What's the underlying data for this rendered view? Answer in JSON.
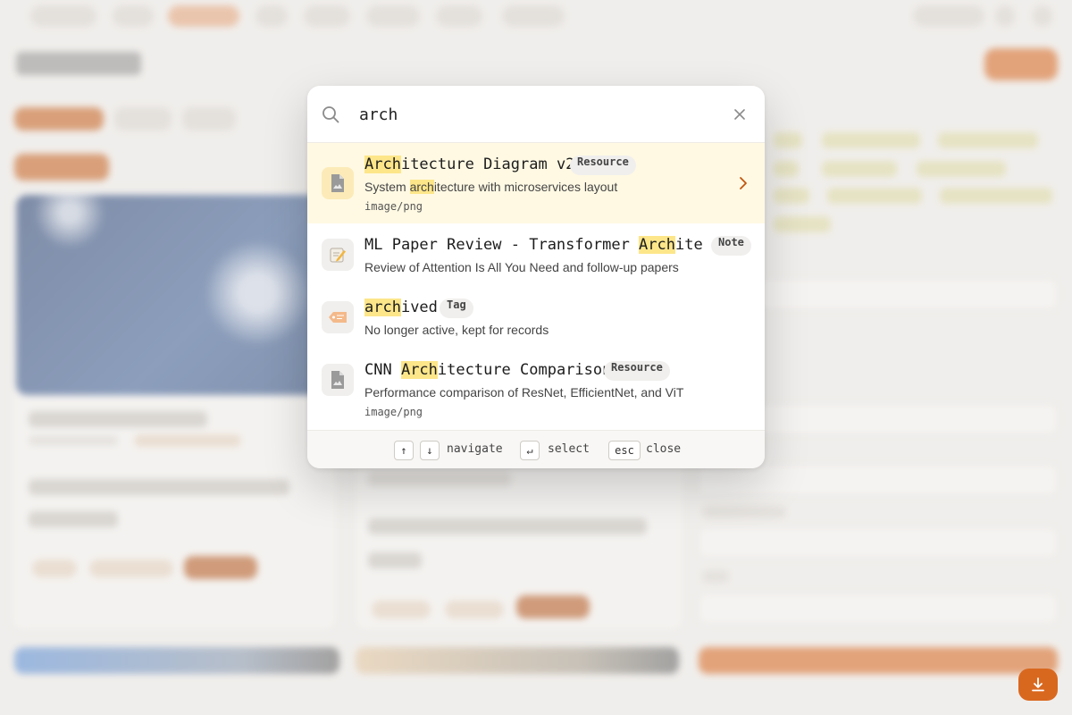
{
  "palette": {
    "query": "arch",
    "results": [
      {
        "icon": "image-file-icon",
        "title_pre": "",
        "title_match": "Arch",
        "title_post": "itecture Diagram v2",
        "type": "Resource",
        "desc_pre": "System ",
        "desc_match": "arch",
        "desc_post": "itecture with microservices layout",
        "mime": "image/png"
      },
      {
        "icon": "note-icon",
        "title_pre": "ML Paper Review - Transformer ",
        "title_match": "Arch",
        "title_post": "itec…",
        "type": "Note",
        "desc": "Review of Attention Is All You Need and follow-up papers"
      },
      {
        "icon": "tag-icon",
        "title_pre": "",
        "title_match": "arch",
        "title_post": "ived",
        "type": "Tag",
        "desc": "No longer active, kept for records"
      },
      {
        "icon": "image-file-icon",
        "title_pre": "CNN ",
        "title_match": "Arch",
        "title_post": "itecture Comparison",
        "type": "Resource",
        "desc": "Performance comparison of ResNet, EfficientNet, and ViT",
        "mime": "image/png"
      }
    ],
    "footer": {
      "up_key": "↑",
      "down_key": "↓",
      "navigate_label": "navigate",
      "enter_key": "↵",
      "select_label": "select",
      "esc_key": "esc",
      "close_label": "close"
    }
  },
  "colors": {
    "accent": "#d9681f",
    "highlight": "#fde68a",
    "selected_row": "#fff9e3"
  }
}
